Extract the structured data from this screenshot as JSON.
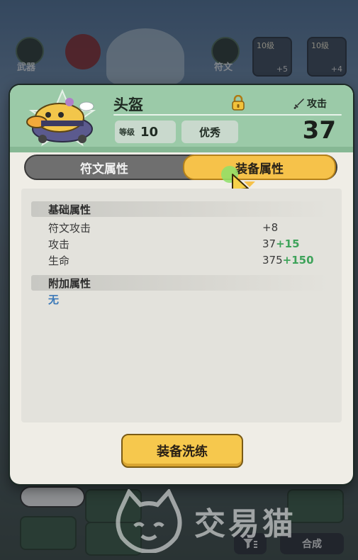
{
  "background": {
    "weapon_label": "武器",
    "rune_label": "符文",
    "slot1_level": "10级",
    "slot1_plus": "+5",
    "slot2_level": "10级",
    "slot2_plus": "+4",
    "compose_label": "合成"
  },
  "watermark": {
    "text": "交易猫"
  },
  "dialog": {
    "title": "头盔",
    "attack_label": "攻击",
    "attack_value": "37",
    "level_tag": "等级",
    "level_value": "10",
    "quality": "优秀"
  },
  "tabs": {
    "rune_attrs": "符文属性",
    "equip_attrs": "装备属性",
    "selected": "equip_attrs"
  },
  "basic_section": {
    "title": "基础属性",
    "rows": [
      {
        "name": "符文攻击",
        "base": "+8",
        "bonus": ""
      },
      {
        "name": "攻击",
        "base": "37",
        "bonus": "+15"
      },
      {
        "name": "生命",
        "base": "375",
        "bonus": "+150"
      }
    ]
  },
  "extra_section": {
    "title": "附加属性",
    "none_text": "无"
  },
  "refine_button": {
    "label": "装备洗练"
  },
  "colors": {
    "header_green": "#9bcaa8",
    "tab_active": "#f6c24a",
    "bonus_green": "#3ea35a",
    "none_blue": "#3a78b8"
  }
}
